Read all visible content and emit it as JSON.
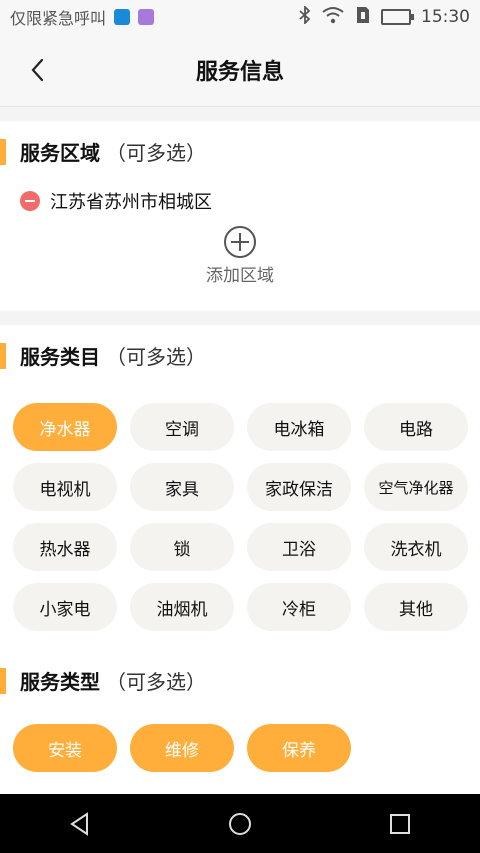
{
  "statusbar": {
    "carrier": "仅限紧急呼叫",
    "time": "15:30",
    "badge1_color": "#1a8ad8",
    "badge2_color": "#a77ad9"
  },
  "header": {
    "title": "服务信息"
  },
  "colors": {
    "accent": "#ffae3b",
    "chip_bg": "#f4f3f0",
    "remove": "#f26b6b"
  },
  "service_area": {
    "title": "服务区域",
    "hint": "（可多选）",
    "areas": [
      "江苏省苏州市相城区"
    ],
    "add_label": "添加区域"
  },
  "service_category": {
    "title": "服务类目",
    "hint": "（可多选）",
    "items": [
      {
        "label": "净水器",
        "selected": true
      },
      {
        "label": "空调",
        "selected": false
      },
      {
        "label": "电冰箱",
        "selected": false
      },
      {
        "label": "电路",
        "selected": false
      },
      {
        "label": "电视机",
        "selected": false
      },
      {
        "label": "家具",
        "selected": false
      },
      {
        "label": "家政保洁",
        "selected": false
      },
      {
        "label": "空气净化器",
        "selected": false
      },
      {
        "label": "热水器",
        "selected": false
      },
      {
        "label": "锁",
        "selected": false
      },
      {
        "label": "卫浴",
        "selected": false
      },
      {
        "label": "洗衣机",
        "selected": false
      },
      {
        "label": "小家电",
        "selected": false
      },
      {
        "label": "油烟机",
        "selected": false
      },
      {
        "label": "冷柜",
        "selected": false
      },
      {
        "label": "其他",
        "selected": false
      }
    ]
  },
  "service_type": {
    "title": "服务类型",
    "hint": "（可多选）",
    "items": [
      {
        "label": "安装",
        "selected": true
      },
      {
        "label": "维修",
        "selected": true
      },
      {
        "label": "保养",
        "selected": true
      }
    ]
  }
}
